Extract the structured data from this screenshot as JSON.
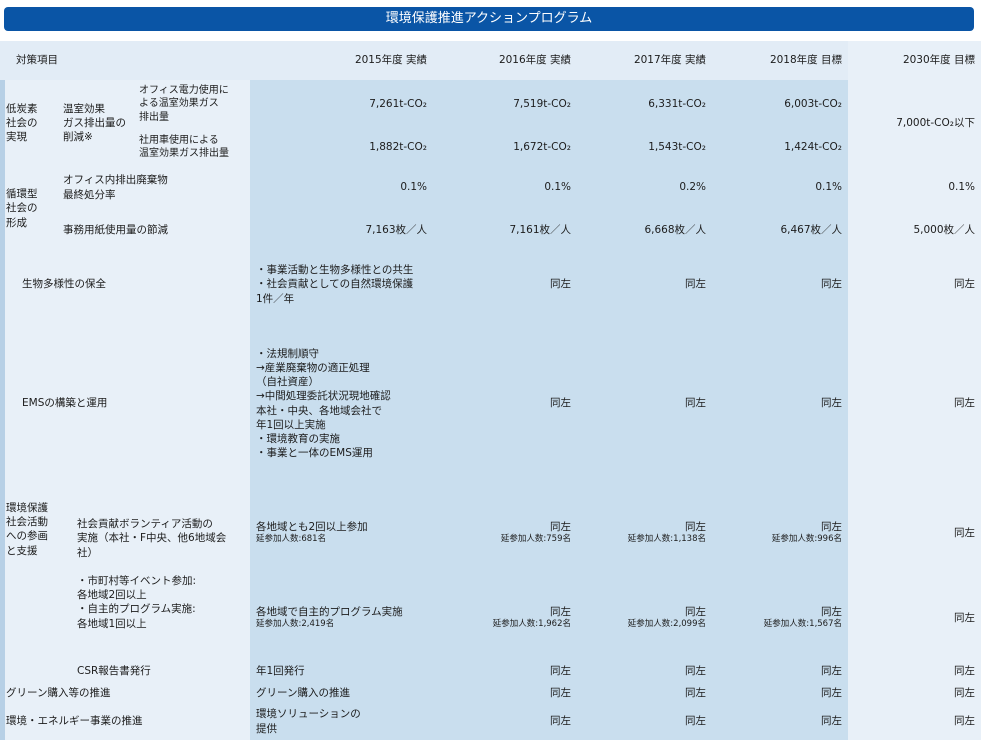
{
  "title": "環境保護推進アクションプログラム",
  "header": [
    "対策項目",
    "2015年度 実績",
    "2016年度 実績",
    "2017年度 実績",
    "2018年度 目標",
    "2030年度 目標"
  ],
  "low_carbon": {
    "cat": "低炭素\n社会の\n実現",
    "sub": "温室効果\nガス排出量の\n削減※",
    "rows": [
      {
        "label": "オフィス電力使用に\nよる温室効果ガス\n排出量",
        "v": [
          "7,261t-CO₂",
          "7,519t-CO₂",
          "6,331t-CO₂",
          "6,003t-CO₂"
        ]
      },
      {
        "label": "社用車使用による\n温室効果ガス排出量",
        "v": [
          "1,882t-CO₂",
          "1,672t-CO₂",
          "1,543t-CO₂",
          "1,424t-CO₂"
        ]
      }
    ],
    "target": "7,000t-CO₂以下"
  },
  "recycle": {
    "cat": "循環型\n社会の\n形成",
    "rows": [
      {
        "label": "オフィス内排出廃棄物\n最終処分率",
        "v": [
          "0.1%",
          "0.1%",
          "0.2%",
          "0.1%",
          "0.1%"
        ]
      },
      {
        "label": "事務用紙使用量の節減",
        "v": [
          "7,163枚／人",
          "7,161枚／人",
          "6,668枚／人",
          "6,467枚／人",
          "5,000枚／人"
        ]
      }
    ]
  },
  "bio": {
    "label": "生物多様性の保全",
    "text": "・事業活動と生物多様性との共生\n・社会貢献としての自然環境保護\n  1件／年",
    "same": "同左"
  },
  "ems": {
    "label": "EMSの構築と運用",
    "text": "・法規制順守\n→産業廃棄物の適正処理\n    （自社資産）\n→中間処理委託状況現地確認\n    本社・中央、各地域会社で\n    年1回以上実施\n・環境教育の実施\n・事業と一体のEMS運用",
    "same": "同左"
  },
  "social": {
    "cat": "環境保護\n社会活動\nへの参画\nと支援",
    "sub": "社会貢献ボランティア活動の\n実施（本社・F中央、他6地域会社）\n\n・市町村等イベント参加:\n  各地域2回以上\n・自主的プログラム実施:\n  各地域1回以上",
    "rows": [
      {
        "main": "各地域とも2回以上参加",
        "note": "延参加人数:681名",
        "v": [
          [
            "同左",
            "延参加人数:759名"
          ],
          [
            "同左",
            "延参加人数:1,138名"
          ],
          [
            "同左",
            "延参加人数:996名"
          ]
        ]
      },
      {
        "main": "各地域で自主的プログラム実施",
        "note": "延参加人数:2,419名",
        "v": [
          [
            "同左",
            "延参加人数:1,962名"
          ],
          [
            "同左",
            "延参加人数:2,099名"
          ],
          [
            "同左",
            "延参加人数:1,567名"
          ]
        ]
      }
    ],
    "same": "同左",
    "csr": {
      "label": "CSR報告書発行",
      "text": "年1回発行"
    }
  },
  "green": {
    "label": "グリーン購入等の推進",
    "text": "グリーン購入の推進"
  },
  "energy": {
    "label": "環境・エネルギー事業の推進",
    "text": "環境ソリューションの\n提供"
  }
}
